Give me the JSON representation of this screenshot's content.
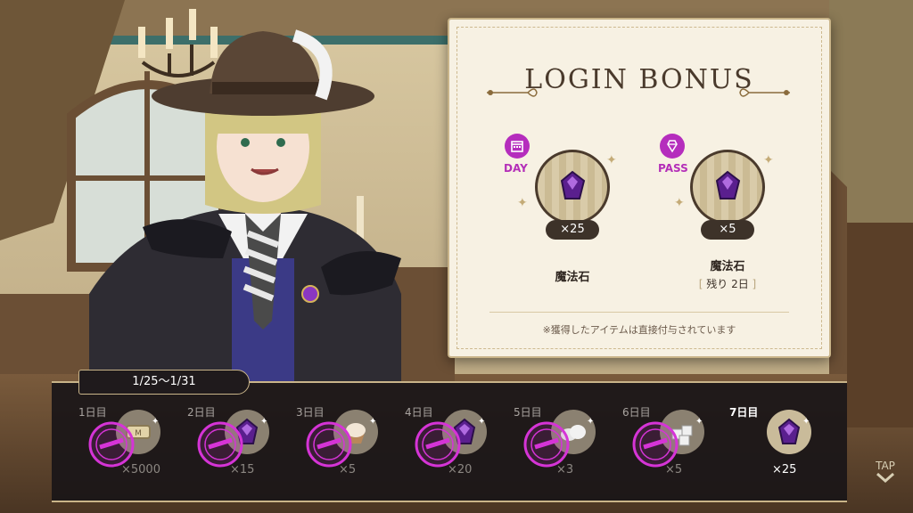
{
  "title": "LOGIN BONUS",
  "rewards": [
    {
      "tag": "DAY",
      "tag_icon": "calendar-icon",
      "item_icon": "magic-stone-icon",
      "qty": "×25",
      "name": "魔法石"
    },
    {
      "tag": "PASS",
      "tag_icon": "diamond-icon",
      "item_icon": "magic-stone-icon",
      "qty": "×5",
      "name": "魔法石",
      "remain": {
        "open": "[",
        "text": "残り 2日",
        "close": "]"
      }
    }
  ],
  "note": "※獲得したアイテムは直接付与されています",
  "period": "1/25～1/31",
  "days": [
    {
      "label": "1日目",
      "qty": "×5000",
      "icon": "madol-coin-icon",
      "claimed": true
    },
    {
      "label": "2日目",
      "qty": "×15",
      "icon": "magic-stone-icon",
      "claimed": true
    },
    {
      "label": "3日目",
      "qty": "×5",
      "icon": "cupcake-icon",
      "claimed": true
    },
    {
      "label": "4日目",
      "qty": "×20",
      "icon": "magic-stone-icon",
      "claimed": true
    },
    {
      "label": "5日目",
      "qty": "×3",
      "icon": "cloud-item-icon",
      "claimed": true
    },
    {
      "label": "6日目",
      "qty": "×5",
      "icon": "cube-item-icon",
      "claimed": true
    },
    {
      "label": "7日目",
      "qty": "×25",
      "icon": "magic-stone-icon",
      "claimed": false
    }
  ],
  "tap": "TAP",
  "colors": {
    "accent": "#b52dbd",
    "panel": "#f7f1e3",
    "strip": "#1a1618",
    "gold": "#c9b489"
  }
}
